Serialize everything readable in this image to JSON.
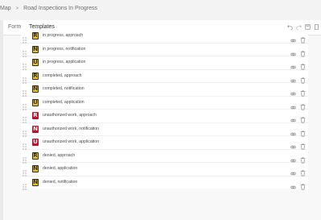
{
  "breadcrumb": {
    "parent": "Map",
    "separator": ">",
    "current": "Road Inspections In Progress"
  },
  "tabs": [
    {
      "label": "Form",
      "active": false
    },
    {
      "label": "Templates",
      "active": true
    }
  ],
  "toolbar": {
    "undo_icon": "undo-icon",
    "redo_icon": "redo-icon",
    "save_icon": "save-icon",
    "more_icon": "more-icon"
  },
  "colors": {
    "accent": "#007ac2",
    "badge_yellow": "#f2c400",
    "badge_dark": "#2d2d2d",
    "badge_red": "#c0102a"
  },
  "templates": [
    {
      "label": "in progress, approach",
      "letter": "R",
      "badge": "yellow"
    },
    {
      "label": "in progress, notification",
      "letter": "N",
      "badge": "yellow"
    },
    {
      "label": "in progress, application",
      "letter": "U",
      "badge": "yellow"
    },
    {
      "label": "completed, approach",
      "letter": "R",
      "badge": "yellow"
    },
    {
      "label": "completed, notification",
      "letter": "N",
      "badge": "yellow"
    },
    {
      "label": "completed, application",
      "letter": "U",
      "badge": "yellow"
    },
    {
      "label": "unauthorized work, approach",
      "letter": "R",
      "badge": "red"
    },
    {
      "label": "unauthorized work, notification",
      "letter": "N",
      "badge": "red"
    },
    {
      "label": "unauthorized work, application",
      "letter": "U",
      "badge": "red"
    },
    {
      "label": "denied, approach",
      "letter": "R",
      "badge": "yellow"
    },
    {
      "label": "denied, application",
      "letter": "N",
      "badge": "yellow"
    },
    {
      "label": "denied, notification",
      "letter": "N",
      "badge": "yellow"
    }
  ]
}
